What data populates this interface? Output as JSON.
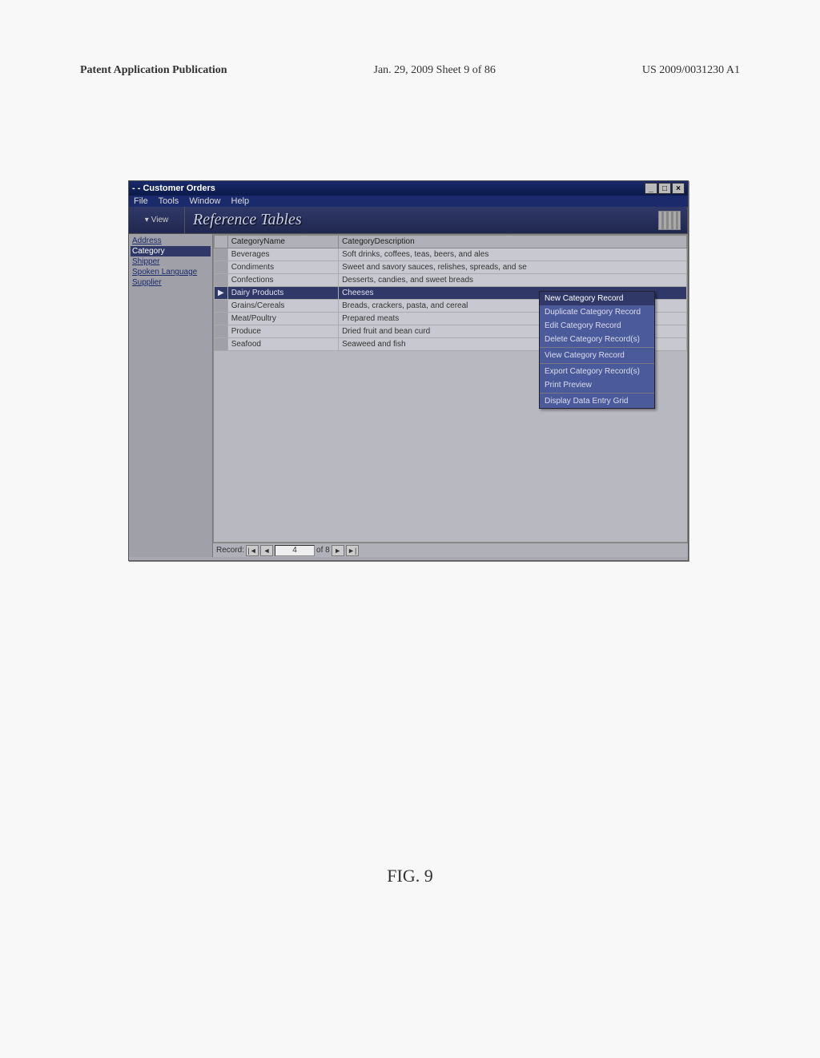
{
  "page_header": {
    "left": "Patent Application Publication",
    "center": "Jan. 29, 2009  Sheet 9 of 86",
    "right": "US 2009/0031230 A1"
  },
  "window": {
    "title": "- - Customer Orders",
    "menu": {
      "file": "File",
      "tools": "Tools",
      "window": "Window",
      "help": "Help"
    },
    "controls": {
      "min": "_",
      "max": "□",
      "close": "×"
    }
  },
  "toolbar": {
    "view": "View",
    "banner": "Reference Tables"
  },
  "sidebar": {
    "items": [
      {
        "label": "Address",
        "selected": false
      },
      {
        "label": "Category",
        "selected": true
      },
      {
        "label": "Shipper",
        "selected": false
      },
      {
        "label": "Spoken Language",
        "selected": false
      },
      {
        "label": "Supplier",
        "selected": false
      }
    ]
  },
  "grid": {
    "columns": {
      "name": "CategoryName",
      "desc": "CategoryDescription"
    },
    "rows": [
      {
        "name": "Beverages",
        "desc": "Soft drinks, coffees, teas, beers, and ales",
        "selected": false
      },
      {
        "name": "Condiments",
        "desc": "Sweet and savory sauces, relishes, spreads, and se",
        "selected": false
      },
      {
        "name": "Confections",
        "desc": "Desserts, candies, and sweet breads",
        "selected": false
      },
      {
        "name": "Dairy Products",
        "desc": "Cheeses",
        "selected": true
      },
      {
        "name": "Grains/Cereals",
        "desc": "Breads, crackers, pasta, and cereal",
        "selected": false
      },
      {
        "name": "Meat/Poultry",
        "desc": "Prepared meats",
        "selected": false
      },
      {
        "name": "Produce",
        "desc": "Dried fruit and bean curd",
        "selected": false
      },
      {
        "name": "Seafood",
        "desc": "Seaweed and fish",
        "selected": false
      }
    ]
  },
  "record_nav": {
    "label": "Record:",
    "first": "|◄",
    "prev": "◄",
    "value": "4",
    "of_text": "of 8",
    "next": "►",
    "last": "►|"
  },
  "context_menu": {
    "items": [
      {
        "label": "New Category Record",
        "hl": true,
        "sep": false
      },
      {
        "label": "Duplicate Category Record",
        "hl": false,
        "sep": false
      },
      {
        "label": "Edit Category Record",
        "hl": false,
        "sep": false
      },
      {
        "label": "Delete Category Record(s)",
        "hl": false,
        "sep": true
      },
      {
        "label": "View Category Record",
        "hl": false,
        "sep": true
      },
      {
        "label": "Export Category Record(s)",
        "hl": false,
        "sep": false
      },
      {
        "label": "Print Preview",
        "hl": false,
        "sep": true
      },
      {
        "label": "Display Data Entry Grid",
        "hl": false,
        "sep": false
      }
    ]
  },
  "figure": "FIG. 9"
}
